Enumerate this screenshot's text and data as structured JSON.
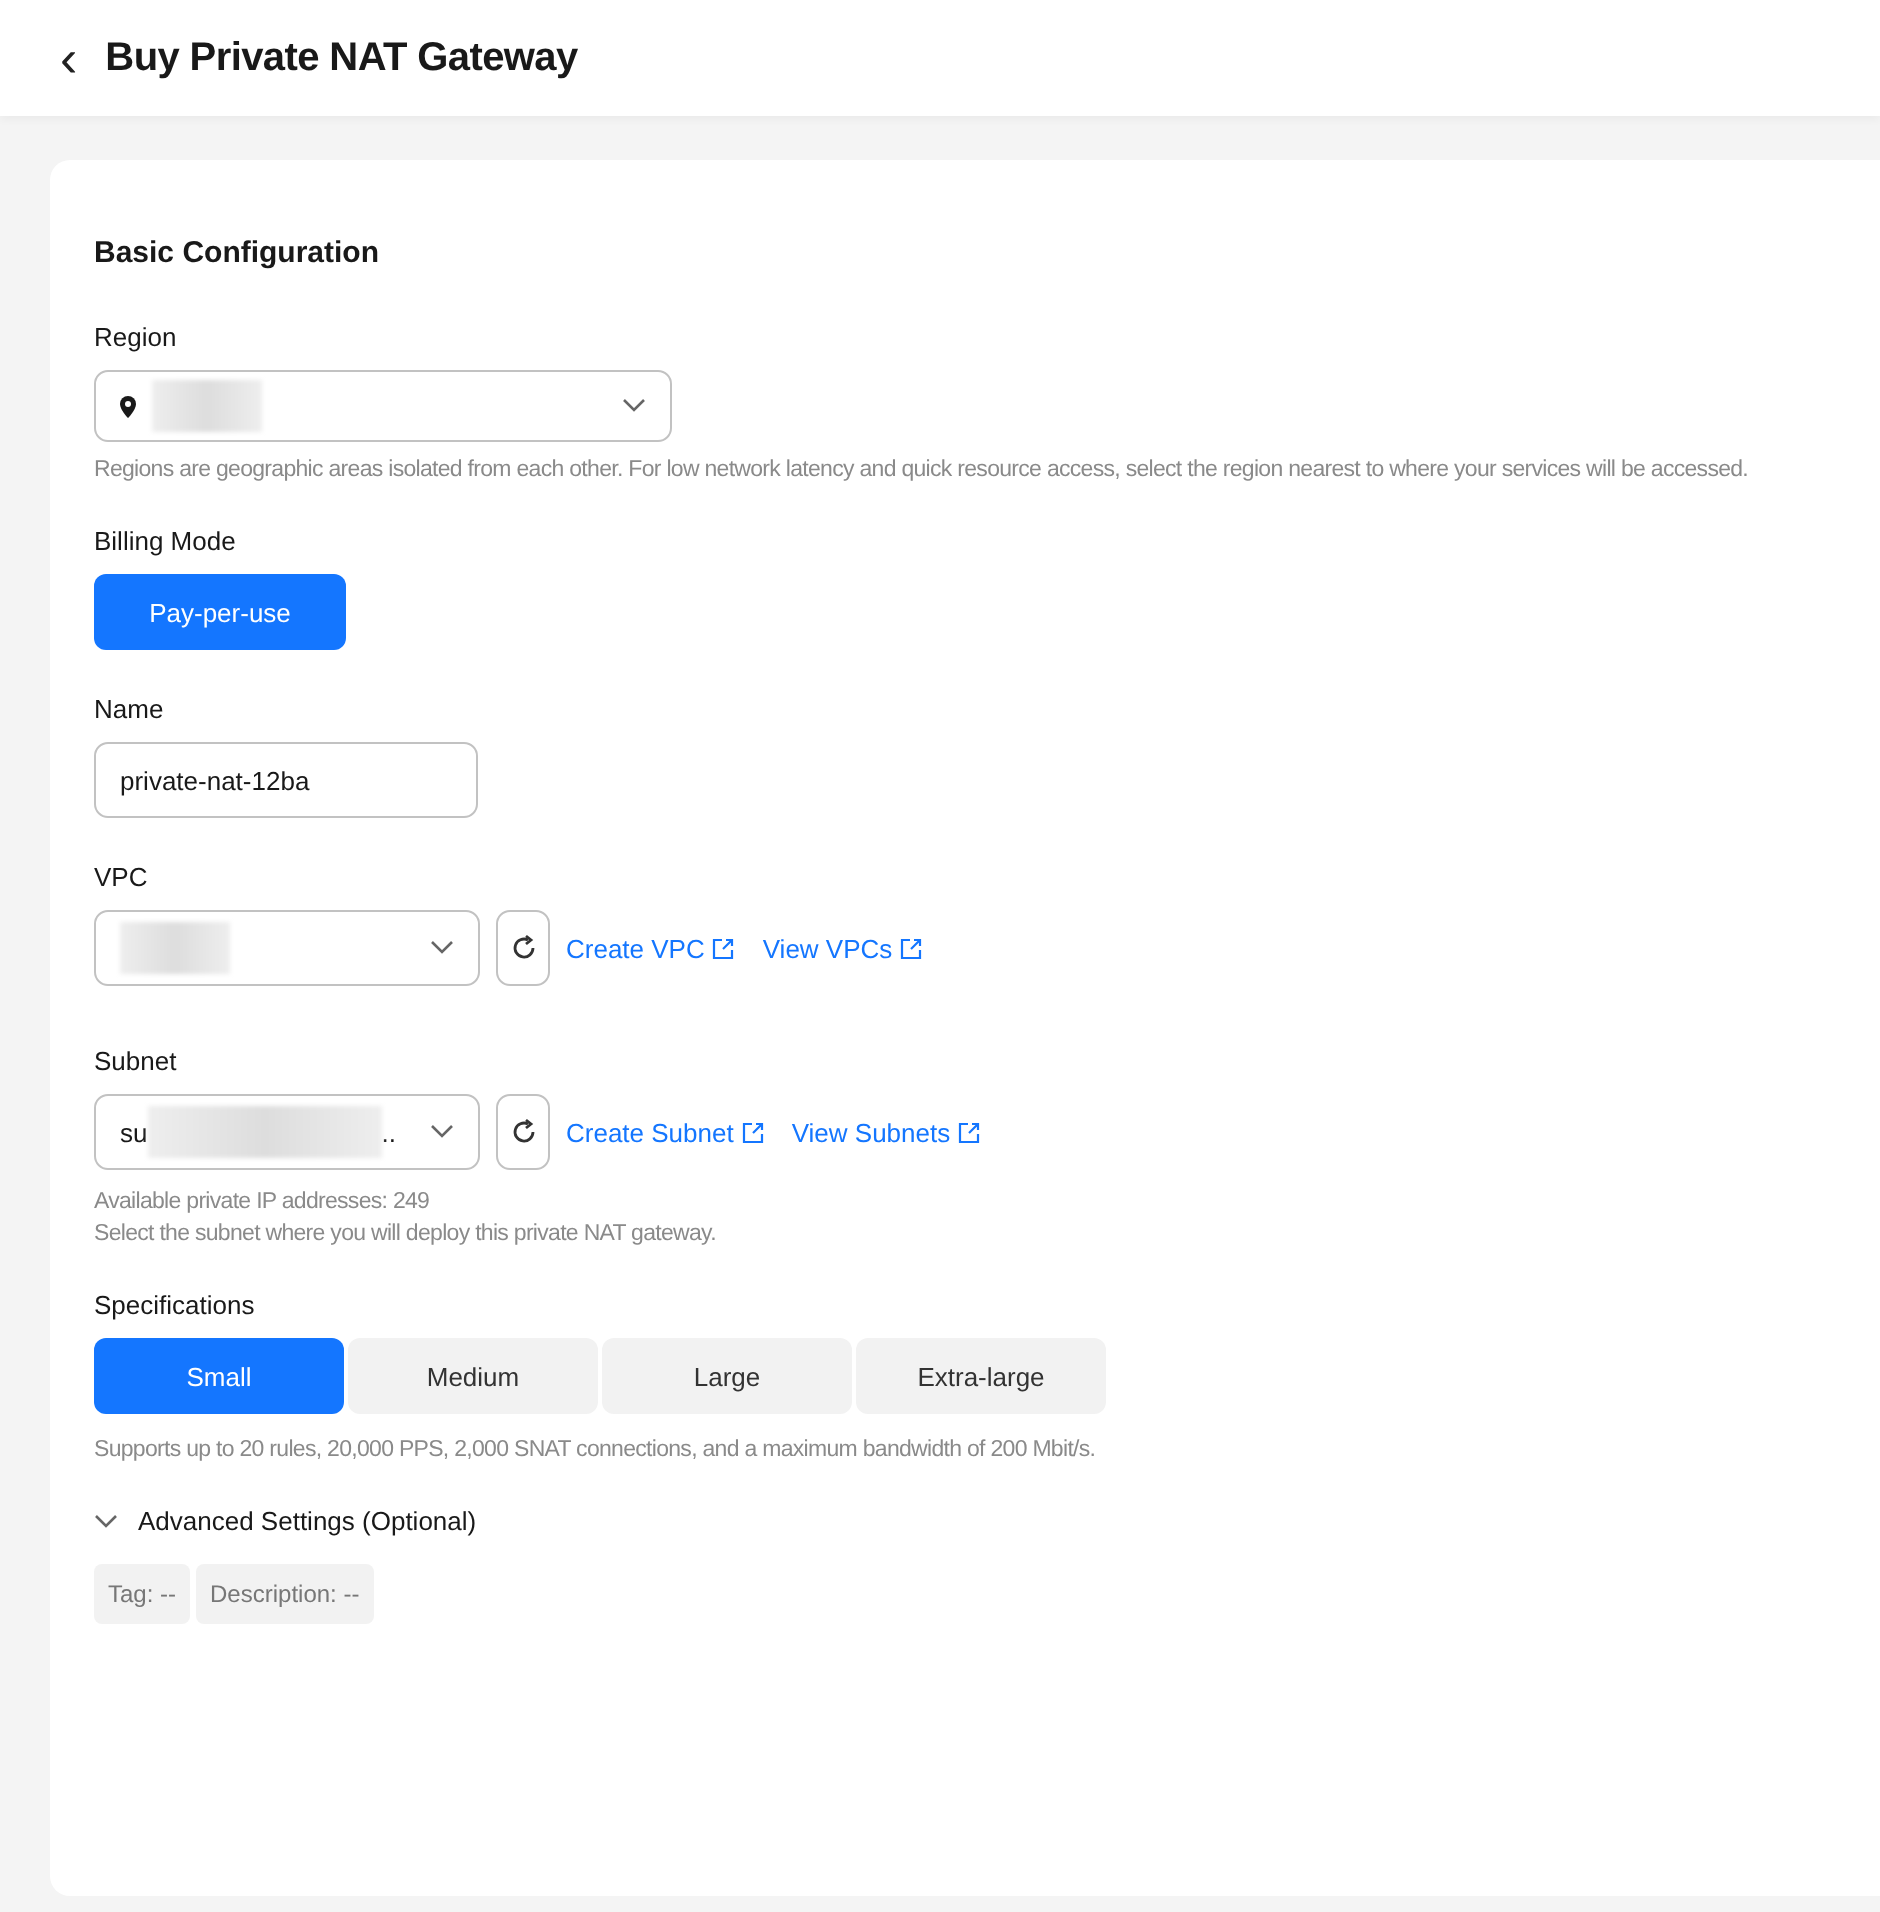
{
  "header": {
    "back": "‹",
    "title": "Buy Private NAT Gateway"
  },
  "section": {
    "title": "Basic Configuration"
  },
  "region": {
    "label": "Region",
    "redacted": true,
    "hint": "Regions are geographic areas isolated from each other. For low network latency and quick resource access, select the region nearest to where your services will be accessed."
  },
  "billing": {
    "label": "Billing Mode",
    "options": [
      {
        "label": "Pay-per-use",
        "selected": true
      }
    ]
  },
  "name": {
    "label": "Name",
    "value": "private-nat-12ba"
  },
  "vpc": {
    "label": "VPC",
    "redacted": true,
    "links": [
      "Create VPC",
      "View VPCs"
    ]
  },
  "subnet": {
    "label": "Subnet",
    "value_start": "su",
    "value_end": "..",
    "redacted": true,
    "links": [
      "Create Subnet",
      "View Subnets"
    ],
    "hints": [
      "Available private IP addresses: 249",
      "Select the subnet where you will deploy this private NAT gateway."
    ]
  },
  "specifications": {
    "label": "Specifications",
    "options": [
      {
        "label": "Small",
        "selected": true
      },
      {
        "label": "Medium",
        "selected": false
      },
      {
        "label": "Large",
        "selected": false
      },
      {
        "label": "Extra-large",
        "selected": false
      }
    ],
    "hint": "Supports up to 20 rules, 20,000 PPS, 2,000 SNAT connections, and a maximum bandwidth of 200 Mbit/s."
  },
  "advanced": {
    "title": "Advanced Settings (Optional)",
    "expanded": true,
    "tags": [
      "Tag: --",
      "Description: --"
    ]
  }
}
